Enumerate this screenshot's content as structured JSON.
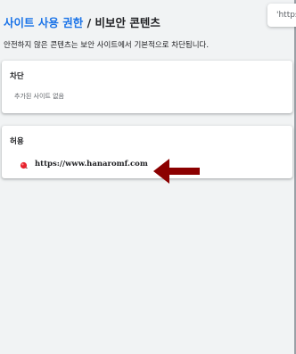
{
  "header": {
    "crumb_parent": "사이트 사용 권한",
    "separator": "/",
    "crumb_current": "비보안 콘텐츠"
  },
  "search": {
    "text": "'https:"
  },
  "description": "안전하지 않은 콘텐츠는 보안 사이트에서 기본적으로 차단됩니다.",
  "block_section": {
    "title": "차단",
    "empty_text": "추가된 사이트 없음"
  },
  "allow_section": {
    "title": "허용",
    "sites": [
      {
        "url": "https://www.hanaromf.com"
      }
    ]
  },
  "colors": {
    "link": "#1a73e8",
    "annotation_arrow": "#8b0000"
  }
}
